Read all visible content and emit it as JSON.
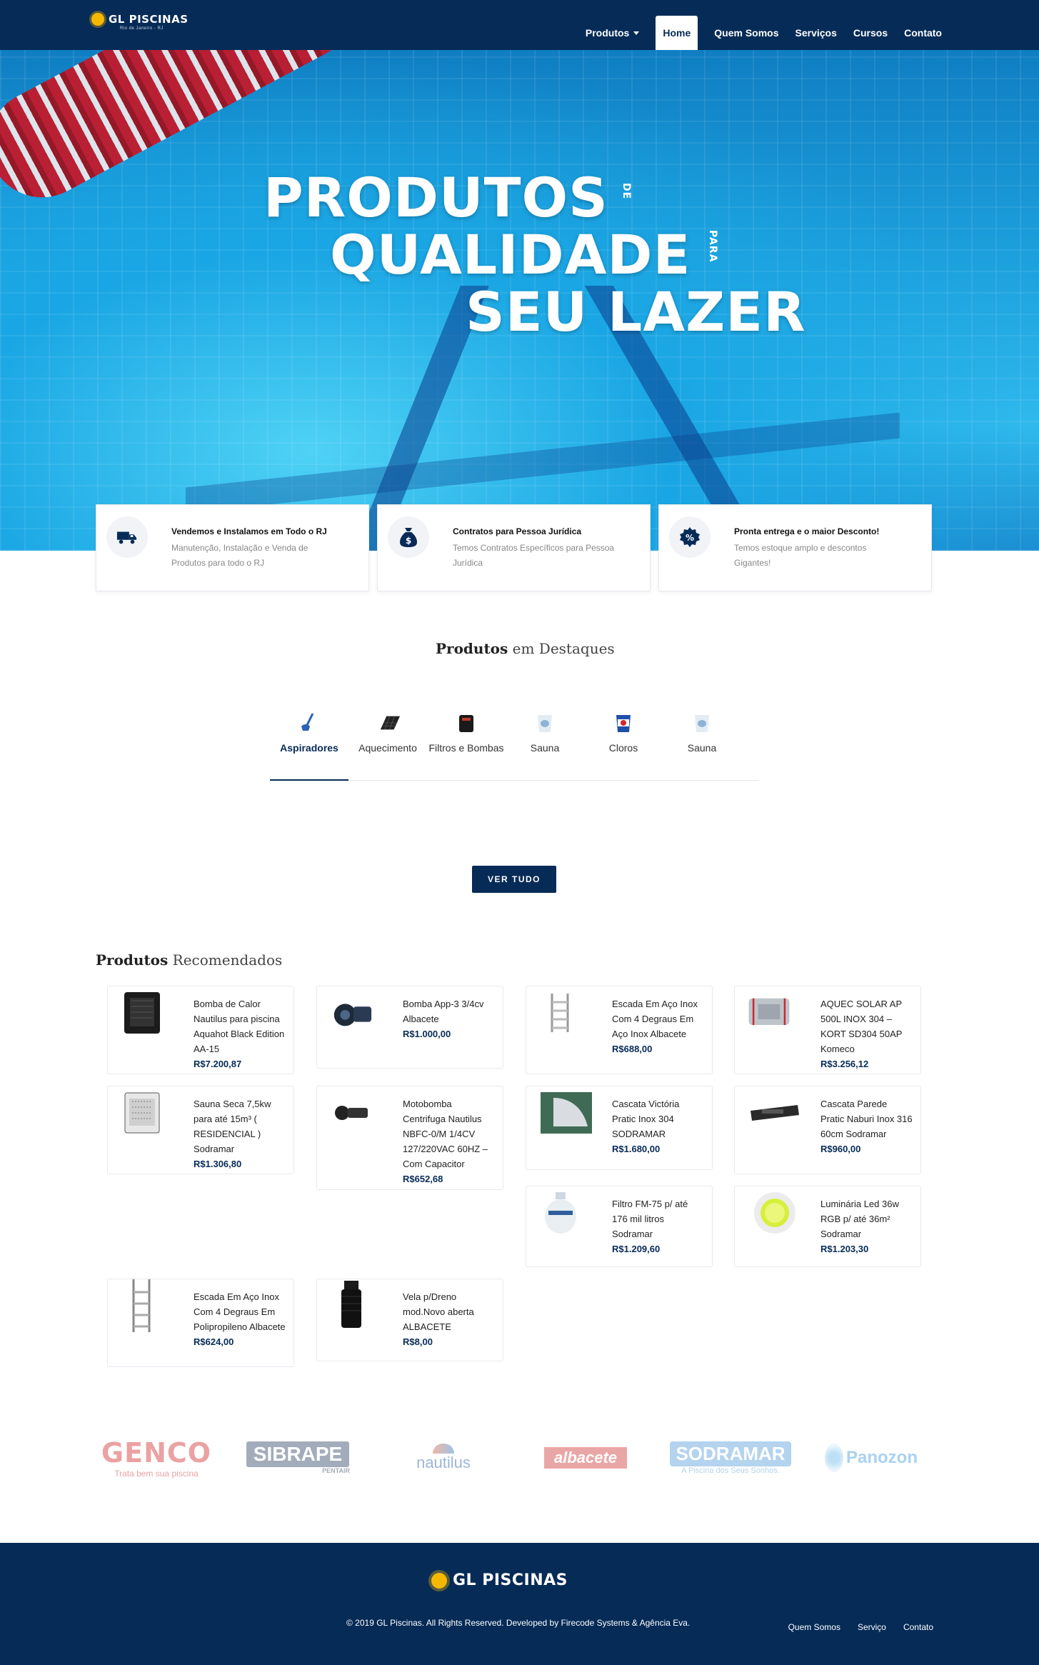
{
  "brand": {
    "name": "GL PISCINAS",
    "tagline": "Rio de Janeiro - RJ"
  },
  "nav": {
    "items": [
      {
        "label": "Produtos",
        "dropdown": true
      },
      {
        "label": "Home",
        "active": true
      },
      {
        "label": "Quem Somos"
      },
      {
        "label": "Serviços"
      },
      {
        "label": "Cursos"
      },
      {
        "label": "Contato"
      }
    ]
  },
  "hero": {
    "line1": "PRODUTOS",
    "small1": "DE",
    "line2": "QUALIDADE",
    "small2": "PARA",
    "line3": "SEU LAZER"
  },
  "features": [
    {
      "icon": "truck-icon",
      "title": "Vendemos e Instalamos em Todo o RJ",
      "desc": "Manutenção, Instalação e Venda de Produtos para todo o RJ"
    },
    {
      "icon": "money-bag-icon",
      "title": "Contratos para Pessoa Jurídica",
      "desc": "Temos Contratos Específicos para Pessoa Jurídica"
    },
    {
      "icon": "discount-badge-icon",
      "title": "Pronta entrega e o maior Desconto!",
      "desc": "Temos estoque amplo e descontos Gigantes!"
    }
  ],
  "featured": {
    "title_bold": "Produtos",
    "title_rest": " em Destaques",
    "tabs": [
      "Aspiradores",
      "Aquecimento",
      "Filtros e Bombas",
      "Sauna",
      "Cloros",
      "Sauna"
    ],
    "button": "VER TUDO"
  },
  "recommended": {
    "title_bold": "Produtos",
    "title_rest": " Recomendados",
    "products": [
      {
        "name": "Bomba de Calor Nautilus para piscina Aquahot Black Edition AA-15",
        "price": "R$7.200,87"
      },
      {
        "name": "Bomba App-3 3/4cv Albacete",
        "price": "R$1.000,00"
      },
      {
        "name": "Escada Em Aço Inox Com 4 Degraus Em Aço Inox Albacete",
        "price": "R$688,00"
      },
      {
        "name": "AQUEC SOLAR AP 500L INOX 304 – KORT SD304 50AP Komeco",
        "price": "R$3.256,12"
      },
      {
        "name": "Sauna Seca 7,5kw para até 15m³ ( RESIDENCIAL ) Sodramar",
        "price": "R$1.306,80"
      },
      {
        "name": "Motobomba Centrifuga Nautilus NBFC-0/M 1/4CV 127/220VAC 60HZ – Com Capacitor",
        "price": "R$652,68"
      },
      {
        "name": "Cascata Victória Pratic Inox 304 SODRAMAR",
        "price": "R$1.680,00"
      },
      {
        "name": "Cascata Parede Pratic Naburi Inox 316 60cm Sodramar",
        "price": "R$960,00"
      },
      {
        "name": "Filtro FM-75 p/ até 176 mil litros Sodramar",
        "price": "R$1.209,60"
      },
      {
        "name": "Luminária Led 36w RGB p/ até 36m² Sodramar",
        "price": "R$1.203,30"
      },
      {
        "name": "Escada Em Aço Inox Com 4 Degraus Em Polipropileno Albacete",
        "price": "R$624,00"
      },
      {
        "name": "Vela p/Dreno mod.Novo aberta ALBACETE",
        "price": "R$8,00"
      }
    ]
  },
  "brands": [
    {
      "name": "GENCO",
      "sub": "Trata bem sua piscina",
      "color": "#e99a9a"
    },
    {
      "name": "SIBRAPE",
      "sub": "PENTAIR",
      "color": "#9aa3b3"
    },
    {
      "name": "nautilus",
      "sub": "",
      "color": "#9db6d8"
    },
    {
      "name": "albacete",
      "sub": "",
      "color": "#e6a0a0"
    },
    {
      "name": "SODRAMAR",
      "sub": "A Piscina dos Seus Sonhos.",
      "color": "#a8cbe8"
    },
    {
      "name": "Panozon",
      "sub": "",
      "color": "#a9d2ee"
    }
  ],
  "footer": {
    "copyright": "© 2019 GL Piscinas. All Rights Reserved. Developed by Firecode Systems & Agência Eva.",
    "links": [
      "Quem Somos",
      "Serviço",
      "Contato"
    ]
  },
  "colors": {
    "primary": "#062b57",
    "accent": "#f5b800"
  }
}
